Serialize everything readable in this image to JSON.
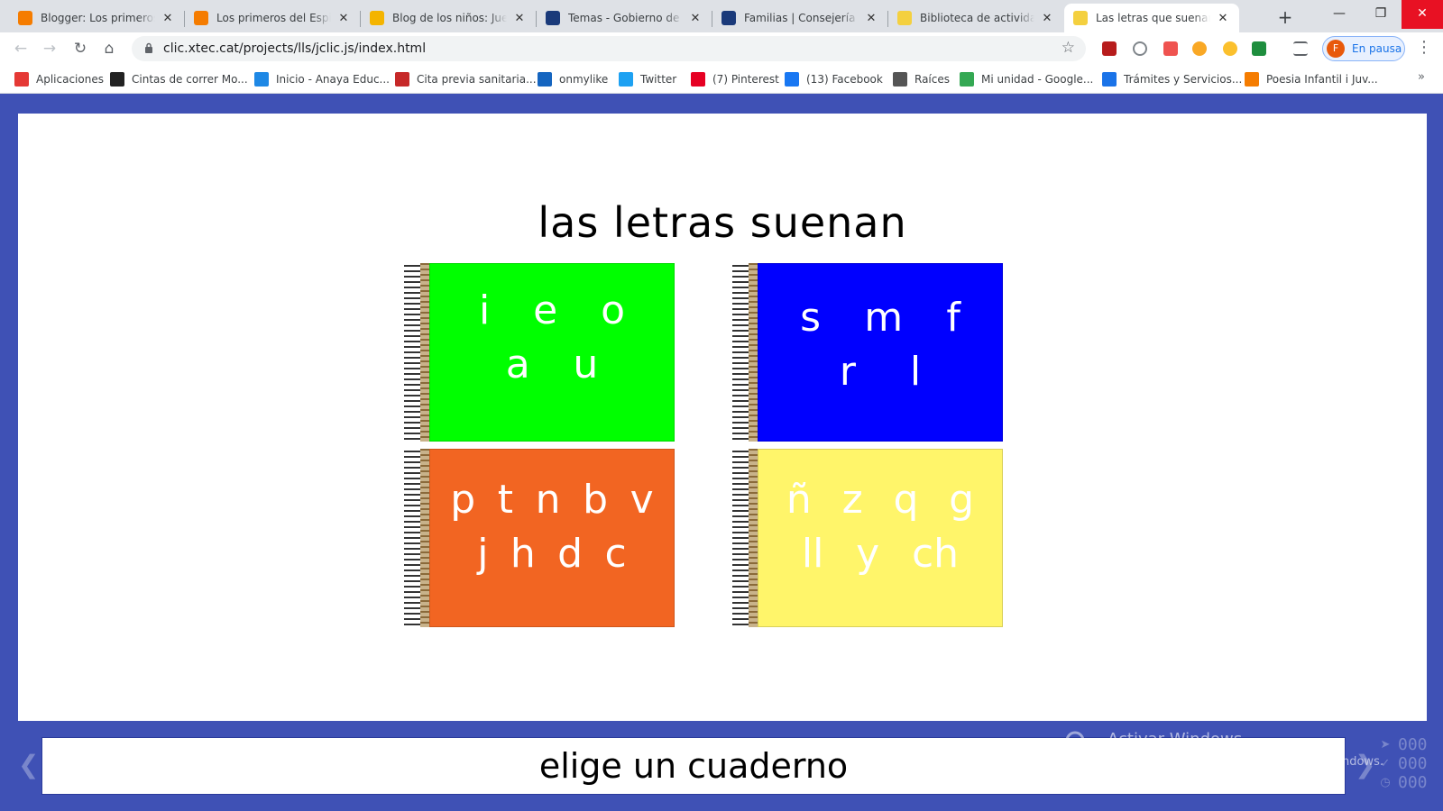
{
  "browser": {
    "tabs": [
      {
        "title": "Blogger: Los primeros del Espinillo",
        "favicon": "blogger-icon",
        "color": "#f57c00"
      },
      {
        "title": "Los primeros del Espinillo",
        "favicon": "blogger-icon",
        "color": "#f57c00"
      },
      {
        "title": "Blog de los niños: Juegos",
        "favicon": "smiley-icon",
        "color": "#f4b400"
      },
      {
        "title": "Temas - Gobierno de Canarias",
        "favicon": "coat-of-arms-icon",
        "color": "#1a3a7a"
      },
      {
        "title": "Familias | Consejería de Educación",
        "favicon": "coat-of-arms-icon",
        "color": "#1a3a7a"
      },
      {
        "title": "Biblioteca de actividades",
        "favicon": "jclic-icon",
        "color": "#f4d03f"
      },
      {
        "title": "Las letras que suenan",
        "favicon": "jclic-icon",
        "color": "#f4d03f",
        "active": true
      }
    ],
    "url": "clic.xtec.cat/projects/lls/jclic.js/index.html",
    "profile": {
      "initial": "F",
      "label": "En pausa"
    },
    "bookmarks": [
      {
        "label": "Aplicaciones",
        "icon": "apps-grid-icon",
        "color": "#e53935"
      },
      {
        "label": "Cintas de correr Mo...",
        "icon": "mf-logo-icon",
        "color": "#222222"
      },
      {
        "label": "Inicio - Anaya Educ...",
        "icon": "anaya-logo-icon",
        "color": "#1e88e5"
      },
      {
        "label": "Cita previa sanitaria...",
        "icon": "health-icon",
        "color": "#c62828"
      },
      {
        "label": "onmylike",
        "icon": "d-logo-icon",
        "color": "#1565c0"
      },
      {
        "label": "Twitter",
        "icon": "twitter-icon",
        "color": "#1da1f2"
      },
      {
        "label": "(7) Pinterest",
        "icon": "pinterest-icon",
        "color": "#e60023"
      },
      {
        "label": "(13) Facebook",
        "icon": "facebook-icon",
        "color": "#1877f2"
      },
      {
        "label": "Raíces",
        "icon": "globe-icon",
        "color": "#555555"
      },
      {
        "label": "Mi unidad - Google...",
        "icon": "google-drive-icon",
        "color": "#34a853"
      },
      {
        "label": "Trámites y Servicios...",
        "icon": "services-icon",
        "color": "#1a73e8"
      },
      {
        "label": "Poesia Infantil i Juv...",
        "icon": "blogger-icon",
        "color": "#f57c00"
      }
    ]
  },
  "activity": {
    "title": "las letras suenan",
    "notebooks": [
      {
        "color": "#00ff00",
        "rows": [
          [
            "i",
            "e",
            "o"
          ],
          [
            "a",
            "u"
          ]
        ]
      },
      {
        "color": "#0000ff",
        "rows": [
          [
            "s",
            "m",
            "f"
          ],
          [
            "r",
            "l"
          ]
        ]
      },
      {
        "color": "#f26522",
        "rows": [
          [
            "p",
            "t",
            "n",
            "b",
            "v"
          ],
          [
            "j",
            "h",
            "d",
            "c"
          ]
        ]
      },
      {
        "color": "#fff56a",
        "rows": [
          [
            "ñ",
            "z",
            "q",
            "g"
          ],
          [
            "ll",
            "y",
            "ch"
          ]
        ]
      }
    ],
    "message": "elige un cuaderno",
    "counters": {
      "actions": "000",
      "score": "000",
      "time": "000"
    }
  },
  "watermark": {
    "heading": "Activar Windows",
    "sub": "Ir a Configuración de PC para activar Windows."
  }
}
